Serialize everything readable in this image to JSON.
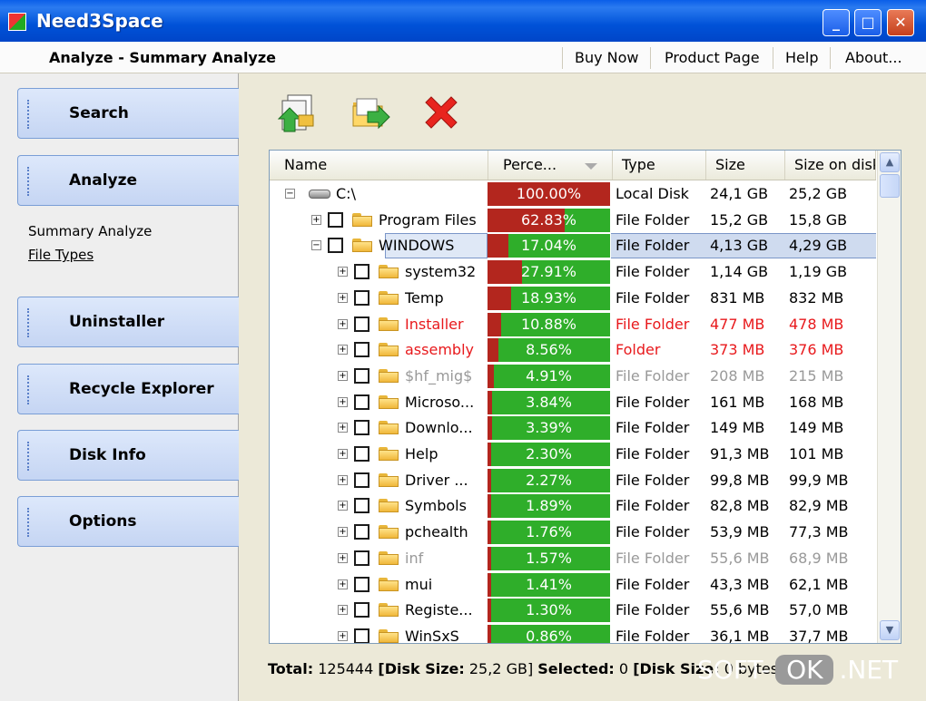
{
  "window": {
    "title": "Need3Space",
    "min": "_",
    "max": "□",
    "close": "✕"
  },
  "menubar": {
    "breadcrumb": "Analyze - Summary Analyze",
    "items": [
      "Buy Now",
      "Product Page",
      "Help",
      "About..."
    ]
  },
  "sidebar": {
    "search": "Search",
    "analyze": "Analyze",
    "sub_summary": "Summary Analyze",
    "sub_filetypes": "File Types",
    "uninstaller": "Uninstaller",
    "recycle": "Recycle Explorer",
    "diskinfo": "Disk Info",
    "options": "Options"
  },
  "toolbar": {
    "icons": [
      "export-icon",
      "move-folder-icon",
      "delete-icon"
    ]
  },
  "columns": {
    "name": "Name",
    "percent": "Perce...",
    "type": "Type",
    "size": "Size",
    "disk": "Size on disk"
  },
  "rows": [
    {
      "name": "C:\\",
      "pct": "100.00%",
      "pv": 1.0,
      "type": "Local Disk",
      "size": "24,1 GB",
      "disk": "25,2 GB"
    },
    {
      "name": "Program Files",
      "pct": "62.83%",
      "pv": 0.6283,
      "type": "File Folder",
      "size": "15,2 GB",
      "disk": "15,8 GB"
    },
    {
      "name": "WINDOWS",
      "pct": "17.04%",
      "pv": 0.1704,
      "type": "File Folder",
      "size": "4,13 GB",
      "disk": "4,29 GB"
    },
    {
      "name": "system32",
      "pct": "27.91%",
      "pv": 0.2791,
      "type": "File Folder",
      "size": "1,14 GB",
      "disk": "1,19 GB"
    },
    {
      "name": "Temp",
      "pct": "18.93%",
      "pv": 0.1893,
      "type": "File Folder",
      "size": "831 MB",
      "disk": "832 MB"
    },
    {
      "name": "Installer",
      "pct": "10.88%",
      "pv": 0.1088,
      "type": "File Folder",
      "size": "477 MB",
      "disk": "478 MB"
    },
    {
      "name": "assembly",
      "pct": "8.56%",
      "pv": 0.0856,
      "type": "Folder",
      "size": "373 MB",
      "disk": "376 MB"
    },
    {
      "name": "$hf_mig$",
      "pct": "4.91%",
      "pv": 0.0491,
      "type": "File Folder",
      "size": "208 MB",
      "disk": "215 MB"
    },
    {
      "name": "Microso...",
      "pct": "3.84%",
      "pv": 0.0384,
      "type": "File Folder",
      "size": "161 MB",
      "disk": "168 MB"
    },
    {
      "name": "Downlo...",
      "pct": "3.39%",
      "pv": 0.0339,
      "type": "File Folder",
      "size": "149 MB",
      "disk": "149 MB"
    },
    {
      "name": "Help",
      "pct": "2.30%",
      "pv": 0.023,
      "type": "File Folder",
      "size": "91,3 MB",
      "disk": "101 MB"
    },
    {
      "name": "Driver ...",
      "pct": "2.27%",
      "pv": 0.0227,
      "type": "File Folder",
      "size": "99,8 MB",
      "disk": "99,9 MB"
    },
    {
      "name": "Symbols",
      "pct": "1.89%",
      "pv": 0.0189,
      "type": "File Folder",
      "size": "82,8 MB",
      "disk": "82,9 MB"
    },
    {
      "name": "pchealth",
      "pct": "1.76%",
      "pv": 0.0176,
      "type": "File Folder",
      "size": "53,9 MB",
      "disk": "77,3 MB"
    },
    {
      "name": "inf",
      "pct": "1.57%",
      "pv": 0.0157,
      "type": "File Folder",
      "size": "55,6 MB",
      "disk": "68,9 MB"
    },
    {
      "name": "mui",
      "pct": "1.41%",
      "pv": 0.0141,
      "type": "File Folder",
      "size": "43,3 MB",
      "disk": "62,1 MB"
    },
    {
      "name": "Registe...",
      "pct": "1.30%",
      "pv": 0.013,
      "type": "File Folder",
      "size": "55,6 MB",
      "disk": "57,0 MB"
    },
    {
      "name": "WinSxS",
      "pct": "0.86%",
      "pv": 0.0086,
      "type": "File Folder",
      "size": "36,1 MB",
      "disk": "37,7 MB"
    }
  ],
  "row_colors": {
    "normal": "#000000",
    "red": "#e8191c",
    "gray": "#999999"
  },
  "row_styles": [
    "normal",
    "normal",
    "normal",
    "normal",
    "normal",
    "red",
    "red",
    "gray",
    "normal",
    "normal",
    "normal",
    "normal",
    "normal",
    "normal",
    "gray",
    "normal",
    "normal",
    "normal"
  ],
  "footer": {
    "total_label": "Total:",
    "total_value": "125444",
    "disk_label": "[Disk Size:",
    "disk_value": "25,2 GB]",
    "selected_label": "Selected:",
    "selected_value": "0",
    "disk2_label": "[Disk Size:",
    "disk2_value": "0 bytes]"
  },
  "watermark": {
    "a": "SOFT-",
    "b": "OK",
    "c": ".NET"
  }
}
